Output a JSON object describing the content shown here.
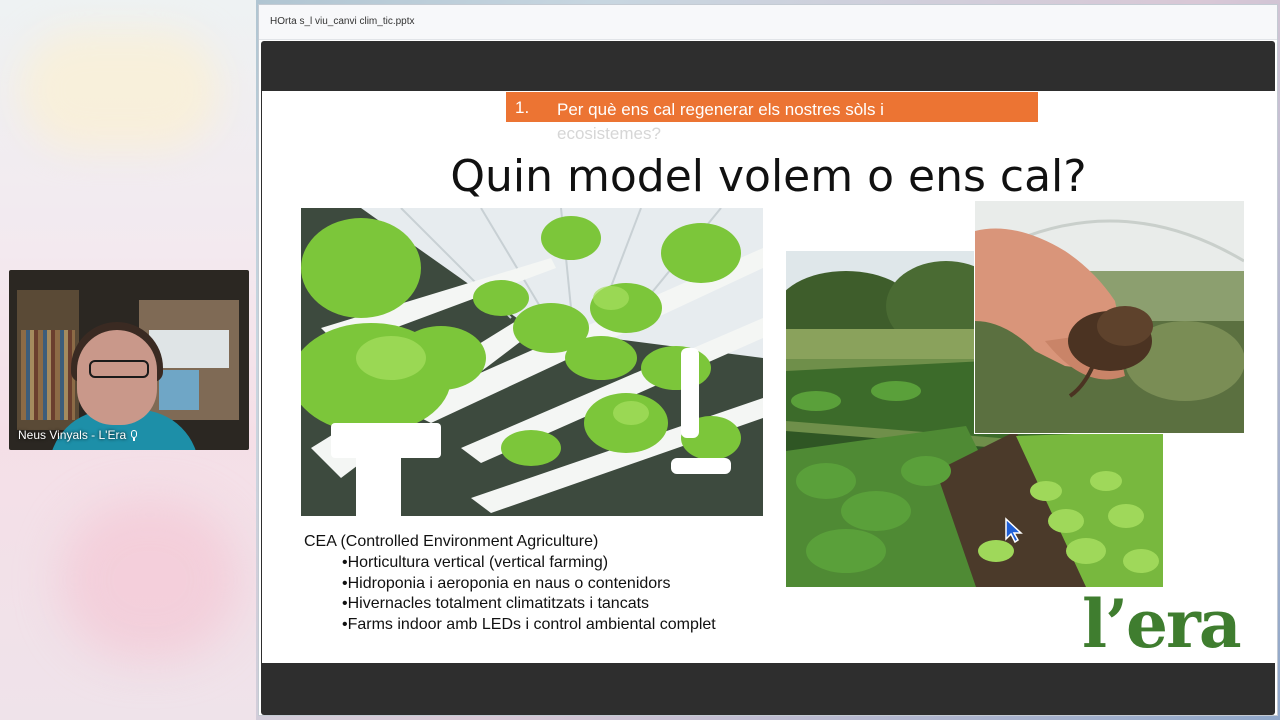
{
  "window": {
    "title": "HOrta s_l viu_canvi clim_tic.pptx"
  },
  "participant": {
    "name": "Neus Vinyals - L'Era"
  },
  "slide": {
    "section_number": "1.",
    "section_line1": "Per què ens cal regenerar els nostres sòls i",
    "section_line2": "ecosistemes?",
    "title": "Quin model volem o ens cal?",
    "cea_heading": "CEA (Controlled Environment Agriculture)",
    "bullets": [
      "•Horticultura vertical (vertical farming)",
      "•Hidroponia i aeroponia en naus o contenidors",
      "•Hivernacles totalment climatitzats i tancats",
      "•Farms indoor amb LEDs i control ambiental complet"
    ],
    "logo": "l’era"
  },
  "colors": {
    "accent": "#ec7433",
    "logo_green": "#3f7d2f",
    "viewer_bg": "#2e2e2e"
  }
}
